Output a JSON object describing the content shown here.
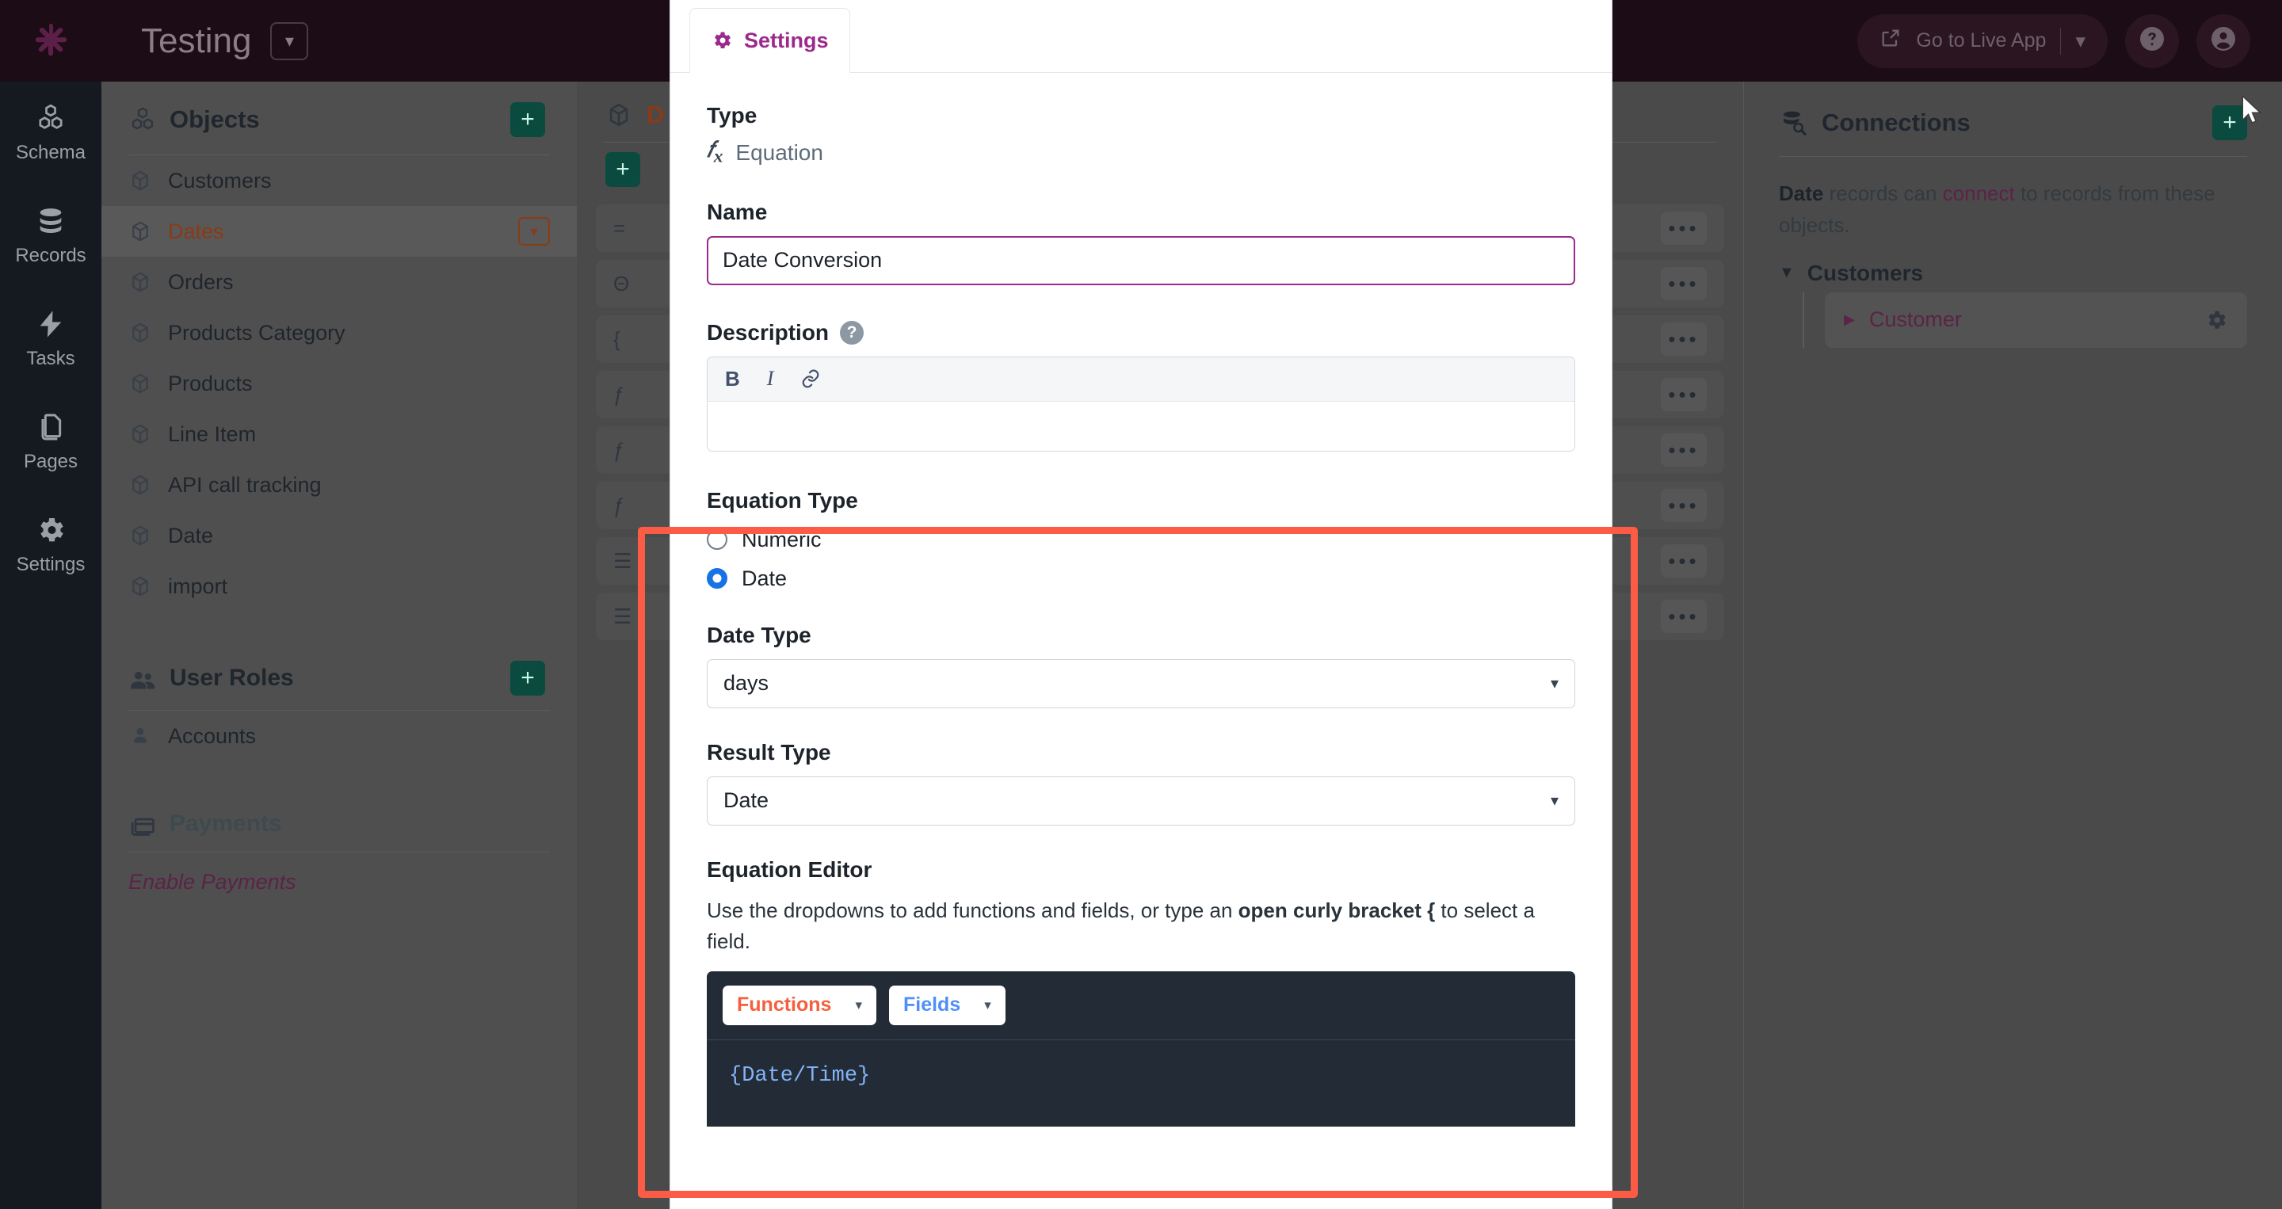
{
  "topbar": {
    "app_title": "Testing",
    "caret_icon": "chevron-down-icon",
    "live_app_label": "Go to Live App",
    "live_app_icon": "external-link-icon",
    "live_app_caret": "chevron-down-icon",
    "help_icon": "question-circle-icon",
    "account_icon": "user-circle-icon"
  },
  "rail": {
    "logo_icon": "asterisk-logo-icon",
    "items": [
      {
        "label": "Schema",
        "icon": "blocks-icon"
      },
      {
        "label": "Records",
        "icon": "database-icon"
      },
      {
        "label": "Tasks",
        "icon": "bolt-icon"
      },
      {
        "label": "Pages",
        "icon": "pages-icon"
      },
      {
        "label": "Settings",
        "icon": "gear-icon"
      }
    ]
  },
  "objects_panel": {
    "title": "Objects",
    "title_icon": "blocks-icon",
    "add_label": "+",
    "items": [
      {
        "label": "Customers",
        "selected": false
      },
      {
        "label": "Dates",
        "selected": true
      },
      {
        "label": "Orders",
        "selected": false
      },
      {
        "label": "Products Category",
        "selected": false
      },
      {
        "label": "Products",
        "selected": false
      },
      {
        "label": "Line Item",
        "selected": false
      },
      {
        "label": "API call tracking",
        "selected": false
      },
      {
        "label": "Date",
        "selected": false
      },
      {
        "label": "import",
        "selected": false
      }
    ],
    "user_roles": {
      "title": "User Roles",
      "title_icon": "users-icon",
      "add_label": "+",
      "items": [
        {
          "label": "Accounts",
          "icon": "user-icon"
        }
      ]
    },
    "payments": {
      "title": "Payments",
      "title_icon": "card-icon",
      "enable_link": "Enable Payments"
    }
  },
  "mid_panel": {
    "title": "D",
    "title_icon": "cube-icon",
    "add_label": "+",
    "rows": [
      {
        "glyph": "=",
        "menu": "•••"
      },
      {
        "glyph": "Θ",
        "menu": "•••"
      },
      {
        "glyph": "{",
        "menu": "•••"
      },
      {
        "glyph": "ƒ",
        "menu": "•••"
      },
      {
        "glyph": "ƒ",
        "menu": "•••"
      },
      {
        "glyph": "ƒ",
        "menu": "•••"
      },
      {
        "glyph": "☰",
        "menu": "•••"
      },
      {
        "glyph": "☰",
        "menu": "•••"
      }
    ]
  },
  "connections": {
    "title": "Connections",
    "title_icon": "connections-icon",
    "add_label": "+",
    "description_prefix": "Date",
    "description_mid": " records can ",
    "description_link": "connect",
    "description_suffix": " to records from these objects.",
    "group_label": "Customers",
    "group_caret": "caret-down-icon",
    "item_label": "Customer",
    "item_caret": "caret-right-icon",
    "item_gear": "gear-icon"
  },
  "modal": {
    "tab": {
      "label": "Settings",
      "icon": "gear-icon"
    },
    "type": {
      "label": "Type",
      "value": "Equation",
      "icon": "fx-icon"
    },
    "name": {
      "label": "Name",
      "value": "Date Conversion",
      "placeholder": ""
    },
    "description": {
      "label": "Description",
      "help_icon": "question-mark-icon",
      "toolbar": {
        "bold": "B",
        "italic": "I",
        "link_icon": "link-icon"
      },
      "value": ""
    },
    "equation_type": {
      "label": "Equation Type",
      "options": [
        {
          "label": "Numeric",
          "selected": false
        },
        {
          "label": "Date",
          "selected": true
        }
      ]
    },
    "date_type": {
      "label": "Date Type",
      "value": "days",
      "caret": "caret-down-icon"
    },
    "result_type": {
      "label": "Result Type",
      "value": "Date",
      "caret": "caret-down-icon"
    },
    "equation_editor": {
      "label": "Equation Editor",
      "hint_pre": "Use the dropdowns to add functions and fields, or type an ",
      "hint_bold": "open curly bracket {",
      "hint_post": " to select a field.",
      "functions_label": "Functions",
      "fields_label": "Fields",
      "caret": "▾",
      "code": "{Date/Time}"
    }
  },
  "highlight": {
    "color": "#fc5b45"
  },
  "colors": {
    "accent_purple": "#9c2a8c",
    "radio_blue": "#1673e6",
    "functions_orange": "#f4603e",
    "fields_blue": "#4f8ff7",
    "add_green": "#0b4a3f",
    "selected_orange": "#8a3a16"
  },
  "cursor": {
    "icon": "mouse-pointer-icon"
  }
}
